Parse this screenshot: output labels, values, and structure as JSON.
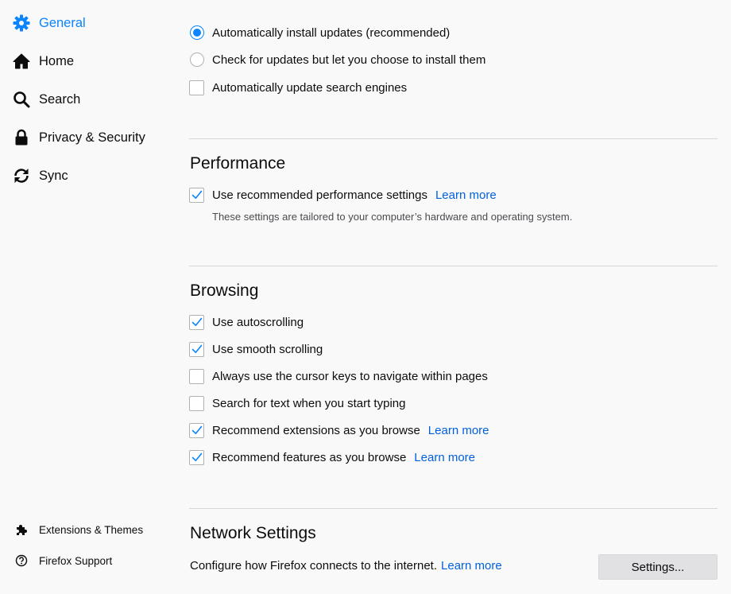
{
  "sidebar": {
    "items": [
      {
        "label": "General",
        "icon": "gear-icon",
        "selected": true
      },
      {
        "label": "Home",
        "icon": "home-icon"
      },
      {
        "label": "Search",
        "icon": "search-icon"
      },
      {
        "label": "Privacy & Security",
        "icon": "lock-icon"
      },
      {
        "label": "Sync",
        "icon": "sync-icon"
      }
    ],
    "footer": [
      {
        "label": "Extensions & Themes",
        "icon": "puzzle-icon"
      },
      {
        "label": "Firefox Support",
        "icon": "help-icon"
      }
    ]
  },
  "updates": {
    "options": [
      {
        "label": "Automatically install updates (recommended)",
        "type": "radio",
        "checked": true
      },
      {
        "label": "Check for updates but let you choose to install them",
        "type": "radio",
        "checked": false
      },
      {
        "label": "Automatically update search engines",
        "type": "checkbox",
        "checked": false
      }
    ]
  },
  "performance": {
    "title": "Performance",
    "recommended": {
      "label": "Use recommended performance settings",
      "checked": true,
      "link": "Learn more"
    },
    "description": "These settings are tailored to your computer’s hardware and operating system."
  },
  "browsing": {
    "title": "Browsing",
    "options": [
      {
        "label": "Use autoscrolling",
        "checked": true
      },
      {
        "label": "Use smooth scrolling",
        "checked": true
      },
      {
        "label": "Always use the cursor keys to navigate within pages",
        "checked": false
      },
      {
        "label": "Search for text when you start typing",
        "checked": false
      },
      {
        "label": "Recommend extensions as you browse",
        "checked": true,
        "link": "Learn more"
      },
      {
        "label": "Recommend features as you browse",
        "checked": true,
        "link": "Learn more"
      }
    ]
  },
  "network": {
    "title": "Network Settings",
    "description": "Configure how Firefox connects to the internet.",
    "link": "Learn more",
    "button": "Settings..."
  },
  "colors": {
    "accent": "#0a84ff",
    "link": "#0060df",
    "background": "#f9f9fa"
  }
}
